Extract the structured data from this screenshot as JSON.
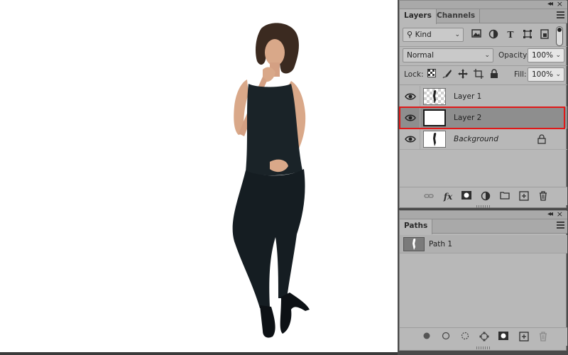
{
  "canvas": {
    "background": "#ffffff"
  },
  "layers_panel": {
    "tabs": [
      {
        "label": "Layers"
      },
      {
        "label": "Channels"
      }
    ],
    "filter": {
      "kind_label": "Kind"
    },
    "blend_mode": "Normal",
    "opacity_label": "Opacity:",
    "opacity_value": "100%",
    "lock_label": "Lock:",
    "fill_label": "Fill:",
    "fill_value": "100%",
    "layers": [
      {
        "name": "Layer 1",
        "visible": true,
        "thumbnail": "transparent-figure"
      },
      {
        "name": "Layer 2",
        "visible": true,
        "thumbnail": "white-fill",
        "selected": true
      },
      {
        "name": "Background",
        "visible": true,
        "thumbnail": "figure",
        "locked": true
      }
    ],
    "footer_icons": [
      "link-icon",
      "fx-icon",
      "mask-icon",
      "adjustment-icon",
      "folder-icon",
      "new-layer-icon",
      "trash-icon"
    ]
  },
  "paths_panel": {
    "tab_label": "Paths",
    "paths": [
      {
        "name": "Path 1"
      }
    ],
    "footer_icons": [
      "fill-path-icon",
      "stroke-path-icon",
      "load-selection-icon",
      "make-workpath-icon",
      "add-mask-icon",
      "new-path-icon",
      "trash-icon"
    ]
  },
  "colors": {
    "selection_outline": "#e01818",
    "panel_bg": "#b8b8b8",
    "selected_row": "#8e8e8e"
  }
}
